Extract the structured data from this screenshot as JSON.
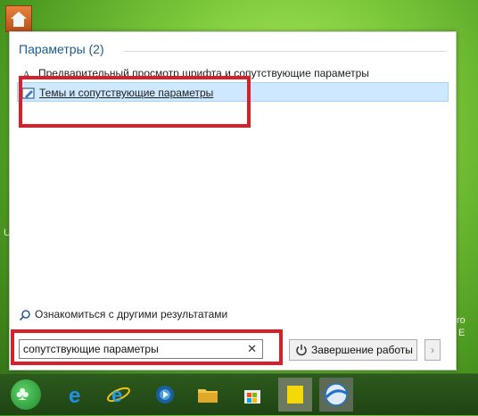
{
  "desktop": {
    "stray_texts": [
      "U",
      "ro",
      "E"
    ]
  },
  "start_menu": {
    "section_title": "Параметры (2)",
    "results": [
      {
        "label": "Предварительный просмотр шрифта и сопутствующие параметры",
        "icon": "font-preview-icon"
      },
      {
        "label": "Темы и сопутствующие параметры",
        "icon": "themes-icon",
        "selected": true
      }
    ],
    "more_results_label": "Ознакомиться с другими результатами",
    "search": {
      "value": "сопутствующие параметры",
      "clear_glyph": "✕"
    },
    "shutdown_label": "Завершение работы",
    "shutdown_arrow_glyph": "›"
  },
  "taskbar": {
    "items": [
      "start-orb",
      "edge",
      "internet-explorer",
      "media-player",
      "file-explorer",
      "store",
      "sticky-notes",
      "browser"
    ]
  },
  "colors": {
    "highlight_red": "#d9202a",
    "selected_bg": "#cde8ff",
    "header_blue": "#1e5a8c"
  }
}
